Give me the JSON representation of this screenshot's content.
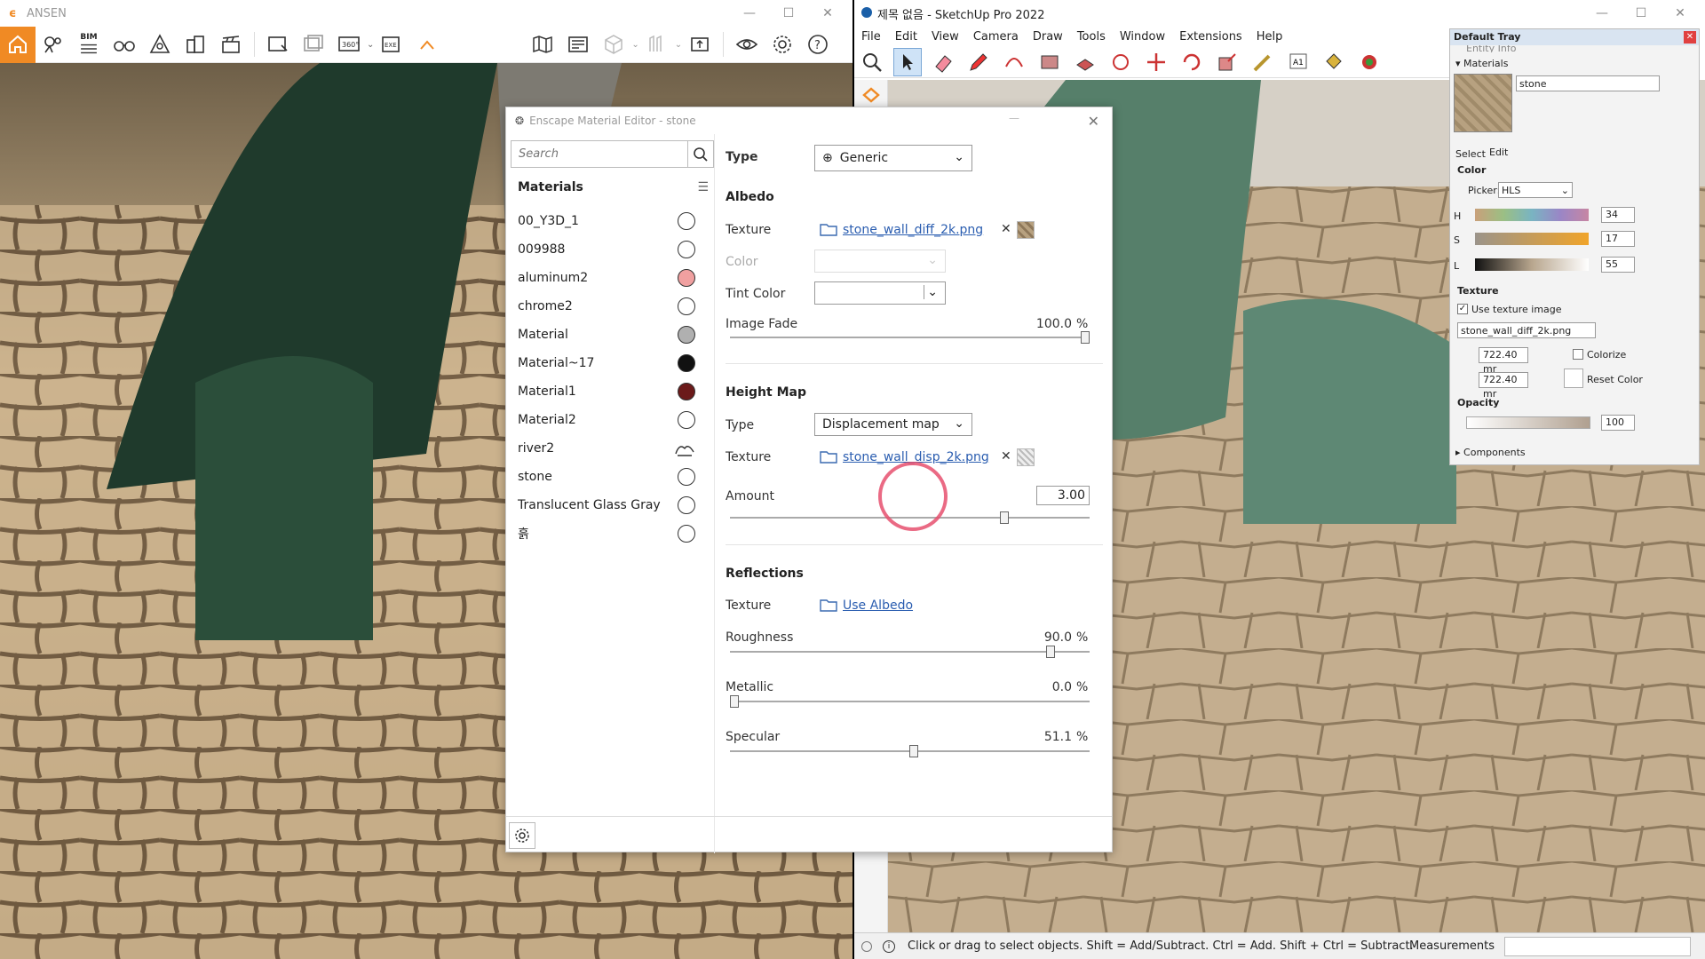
{
  "enscape": {
    "title": "ANSEN",
    "toolbar_icons": [
      "home-icon",
      "asset-library-icon",
      "bim-icon",
      "binoculars-icon",
      "render-icon",
      "building-icon",
      "clapper-icon",
      "screenshot-icon",
      "batch-render-icon",
      "panorama-360-icon",
      "export-exe-icon",
      "collapse-icon",
      "map-icon",
      "video-editor-icon",
      "cube-icon",
      "view-settings-icon",
      "upload-icon",
      "visual-settings-icon",
      "gear-icon",
      "help-icon"
    ],
    "bim_label": "BIM",
    "pano_label": "360°",
    "exe_label": "EXE"
  },
  "material_editor": {
    "title": "Enscape Material Editor - stone",
    "search_placeholder": "Search",
    "materials_header": "Materials",
    "materials": [
      {
        "name": "00_Y3D_1",
        "color": "#ffffff"
      },
      {
        "name": "009988",
        "color": "#ffffff"
      },
      {
        "name": "aluminum2",
        "color": "#f0a0a0"
      },
      {
        "name": "chrome2",
        "color": "#ffffff"
      },
      {
        "name": "Material",
        "color": "#b0b0b0"
      },
      {
        "name": "Material~17",
        "color": "#111111"
      },
      {
        "name": "Material1",
        "color": "#6b1a1a"
      },
      {
        "name": "Material2",
        "color": "#ffffff"
      },
      {
        "name": "river2",
        "color": "water"
      },
      {
        "name": "stone",
        "color": "#ffffff"
      },
      {
        "name": "Translucent Glass Gray",
        "color": "#ffffff"
      },
      {
        "name": "흙",
        "color": "#ffffff"
      }
    ],
    "type_label": "Type",
    "type_value": "Generic",
    "albedo": {
      "header": "Albedo",
      "texture_label": "Texture",
      "texture_file": "stone_wall_diff_2k.png",
      "color_label": "Color",
      "tint_label": "Tint Color",
      "fade_label": "Image Fade",
      "fade_value": "100.0",
      "fade_unit": "%",
      "fade_fraction": 1.0
    },
    "height_map": {
      "header": "Height Map",
      "type_label": "Type",
      "type_value": "Displacement map",
      "texture_label": "Texture",
      "texture_file": "stone_wall_disp_2k.png",
      "amount_label": "Amount",
      "amount_value": "3.00",
      "amount_fraction": 0.77
    },
    "reflections": {
      "header": "Reflections",
      "texture_label": "Texture",
      "texture_link": "Use Albedo",
      "roughness_label": "Roughness",
      "roughness_value": "90.0",
      "roughness_fraction": 0.9,
      "metallic_label": "Metallic",
      "metallic_value": "0.0",
      "metallic_fraction": 0.0,
      "specular_label": "Specular",
      "specular_value": "51.1",
      "specular_fraction": 0.511,
      "unit": "%"
    }
  },
  "sketchup": {
    "title": "제목 없음 - SketchUp Pro 2022",
    "menu": [
      "File",
      "Edit",
      "View",
      "Camera",
      "Draw",
      "Tools",
      "Window",
      "Extensions",
      "Help"
    ],
    "status_text": "Click or drag to select objects. Shift = Add/Subtract. Ctrl = Add. Shift + Ctrl = Subtract.",
    "measurements_label": "Measurements"
  },
  "tray": {
    "title": "Default Tray",
    "entity_info": "Entity Info",
    "materials_label": "Materials",
    "material_name": "stone",
    "tab_select": "Select",
    "tab_edit": "Edit",
    "color_header": "Color",
    "picker_label": "Picker:",
    "picker_value": "HLS",
    "h_label": "H",
    "h_value": "34",
    "s_label": "S",
    "s_value": "17",
    "l_label": "L",
    "l_value": "55",
    "texture_header": "Texture",
    "use_texture": "Use texture image",
    "texture_file": "stone_wall_diff_2k.png",
    "width_value": "722.40 mr",
    "height_value": "722.40 mr",
    "colorize": "Colorize",
    "reset_color": "Reset Color",
    "opacity_header": "Opacity",
    "opacity_value": "100",
    "components": "Components"
  }
}
